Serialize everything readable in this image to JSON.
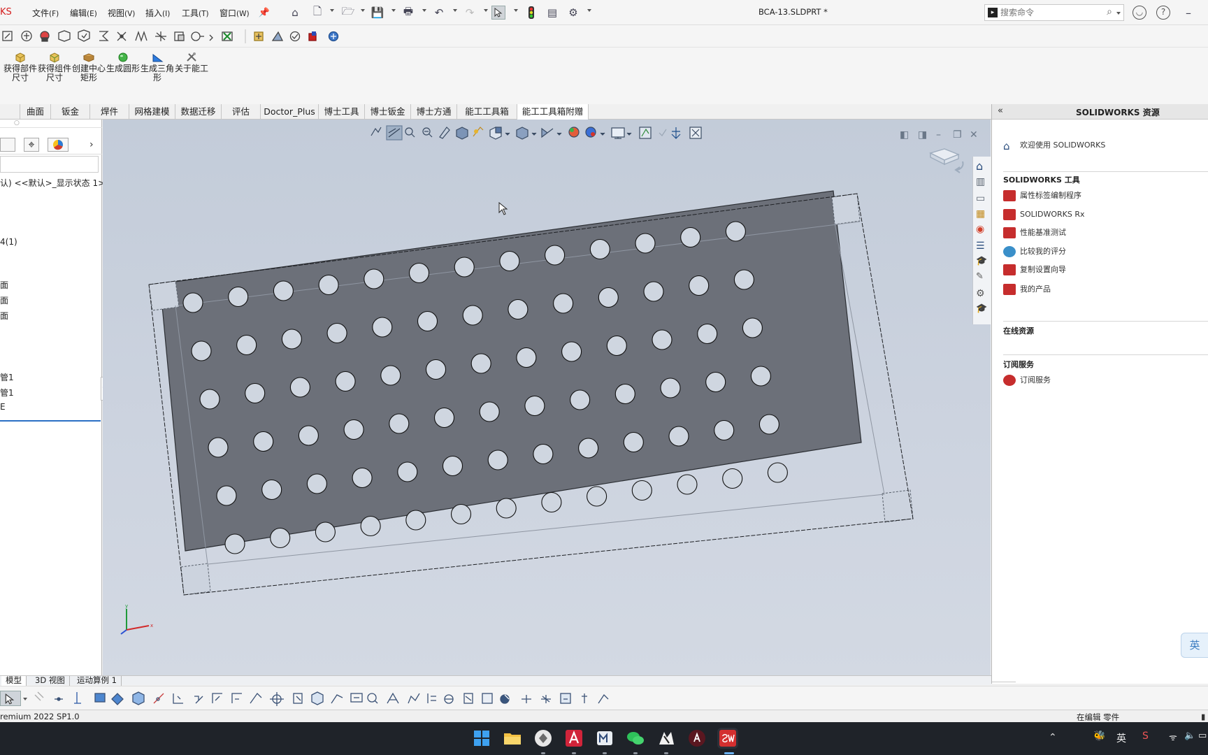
{
  "app": {
    "brand": "KS",
    "document_title": "BCA-13.SLDPRT *"
  },
  "menus": [
    {
      "label": "文件",
      "accel": "(F)"
    },
    {
      "label": "编辑",
      "accel": "(E)"
    },
    {
      "label": "视图",
      "accel": "(V)"
    },
    {
      "label": "插入",
      "accel": "(I)"
    },
    {
      "label": "工具",
      "accel": "(T)"
    },
    {
      "label": "窗口",
      "accel": "(W)"
    }
  ],
  "search": {
    "placeholder": "搜索命令"
  },
  "commands": [
    {
      "label": "获得部件尺寸"
    },
    {
      "label": "获得组件尺寸"
    },
    {
      "label": "创建中心矩形"
    },
    {
      "label": "生成圆形"
    },
    {
      "label": "生成三角形"
    },
    {
      "label": "关于能工"
    }
  ],
  "tabs": [
    "曲面",
    "钣金",
    "焊件",
    "网格建模",
    "数据迁移",
    "评估",
    "Doctor_Plus",
    "博士工具",
    "博士钣金",
    "博士方通",
    "能工工具箱",
    "能工工具箱附赠"
  ],
  "feature_tree": {
    "config_line": "认) <<默认>_显示状态 1>",
    "items": [
      "4(1)",
      "面",
      "面",
      "面",
      "管1",
      "管1",
      "E"
    ]
  },
  "task_pane": {
    "title": "SOLIDWORKS 资源",
    "welcome": "欢迎使用 SOLIDWORKS",
    "tools_header": "SOLIDWORKS 工具",
    "tools": [
      "属性标签编制程序",
      "SOLIDWORKS Rx",
      "性能基准测试",
      "比较我的评分",
      "复制设置向导",
      "我的产品"
    ],
    "online_header": "在线资源",
    "subscription_header": "订阅服务",
    "subscription_items": [
      "订阅服务"
    ]
  },
  "bottom_tabs": [
    "模型",
    "3D 视图",
    "运动算例 1"
  ],
  "status": {
    "version": "remium 2022 SP1.0",
    "editing": "在编辑 零件"
  },
  "ime": {
    "label": "英"
  },
  "taskbar": {
    "ime": "英"
  },
  "triad": {
    "x": "x",
    "y": "y"
  }
}
